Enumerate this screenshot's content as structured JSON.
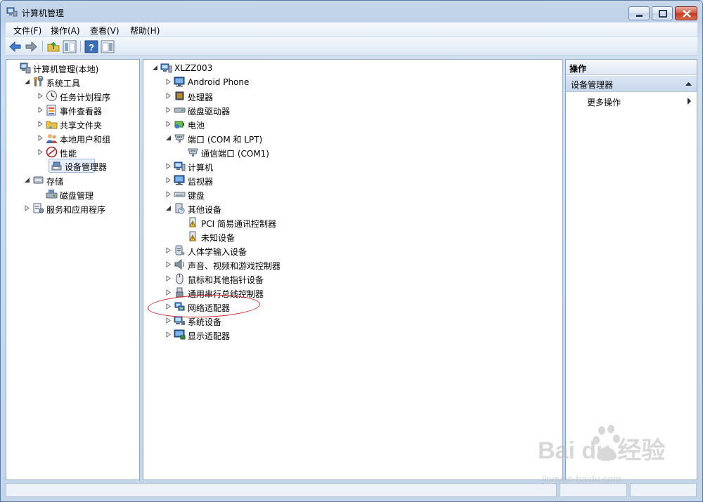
{
  "window": {
    "title": "计算机管理"
  },
  "menu": [
    "文件(F)",
    "操作(A)",
    "查看(V)",
    "帮助(H)"
  ],
  "left_tree": [
    {
      "label": "计算机管理(本地)",
      "icon": "computer-management-icon",
      "indent": 0,
      "expander": "none"
    },
    {
      "label": "系统工具",
      "icon": "tools-icon",
      "indent": 1,
      "expander": "expanded"
    },
    {
      "label": "任务计划程序",
      "icon": "clock-icon",
      "indent": 2,
      "expander": "collapsed"
    },
    {
      "label": "事件查看器",
      "icon": "event-viewer-icon",
      "indent": 2,
      "expander": "collapsed"
    },
    {
      "label": "共享文件夹",
      "icon": "shared-folder-icon",
      "indent": 2,
      "expander": "collapsed"
    },
    {
      "label": "本地用户和组",
      "icon": "users-icon",
      "indent": 2,
      "expander": "collapsed"
    },
    {
      "label": "性能",
      "icon": "performance-icon",
      "indent": 2,
      "expander": "collapsed"
    },
    {
      "label": "设备管理器",
      "icon": "device-manager-icon",
      "indent": 2,
      "expander": "none",
      "selected": true
    },
    {
      "label": "存储",
      "icon": "storage-icon",
      "indent": 1,
      "expander": "expanded"
    },
    {
      "label": "磁盘管理",
      "icon": "disk-management-icon",
      "indent": 2,
      "expander": "none"
    },
    {
      "label": "服务和应用程序",
      "icon": "services-icon",
      "indent": 1,
      "expander": "collapsed"
    }
  ],
  "device_tree": [
    {
      "label": "XLZZ003",
      "icon": "computer-icon",
      "indent": 0,
      "expander": "expanded"
    },
    {
      "label": "Android Phone",
      "icon": "monitor-icon",
      "indent": 1,
      "expander": "collapsed"
    },
    {
      "label": "处理器",
      "icon": "cpu-icon",
      "indent": 1,
      "expander": "collapsed"
    },
    {
      "label": "磁盘驱动器",
      "icon": "disk-drive-icon",
      "indent": 1,
      "expander": "collapsed"
    },
    {
      "label": "电池",
      "icon": "battery-icon",
      "indent": 1,
      "expander": "collapsed"
    },
    {
      "label": "端口 (COM 和 LPT)",
      "icon": "port-icon",
      "indent": 1,
      "expander": "expanded"
    },
    {
      "label": "通信端口 (COM1)",
      "icon": "port-icon",
      "indent": 2,
      "expander": "none"
    },
    {
      "label": "计算机",
      "icon": "computer-icon",
      "indent": 1,
      "expander": "collapsed"
    },
    {
      "label": "监视器",
      "icon": "monitor-icon",
      "indent": 1,
      "expander": "collapsed"
    },
    {
      "label": "键盘",
      "icon": "keyboard-icon",
      "indent": 1,
      "expander": "collapsed"
    },
    {
      "label": "其他设备",
      "icon": "unknown-device-icon",
      "indent": 1,
      "expander": "expanded"
    },
    {
      "label": "PCI 简易通讯控制器",
      "icon": "warning-device-icon",
      "indent": 2,
      "expander": "none"
    },
    {
      "label": "未知设备",
      "icon": "warning-device-icon",
      "indent": 2,
      "expander": "none"
    },
    {
      "label": "人体学输入设备",
      "icon": "hid-icon",
      "indent": 1,
      "expander": "collapsed"
    },
    {
      "label": "声音、视频和游戏控制器",
      "icon": "speaker-icon",
      "indent": 1,
      "expander": "collapsed"
    },
    {
      "label": "鼠标和其他指针设备",
      "icon": "mouse-icon",
      "indent": 1,
      "expander": "collapsed"
    },
    {
      "label": "通用串行总线控制器",
      "icon": "usb-icon",
      "indent": 1,
      "expander": "collapsed"
    },
    {
      "label": "网络适配器",
      "icon": "network-adapter-icon",
      "indent": 1,
      "expander": "collapsed",
      "highlighted": true
    },
    {
      "label": "系统设备",
      "icon": "system-devices-icon",
      "indent": 1,
      "expander": "collapsed"
    },
    {
      "label": "显示适配器",
      "icon": "display-adapter-icon",
      "indent": 1,
      "expander": "collapsed"
    }
  ],
  "actions": {
    "header": "操作",
    "section": "设备管理器",
    "items": [
      "更多操作"
    ]
  },
  "watermark": {
    "text": "Bai du 经验",
    "url_text": "jingyan.baidu.com"
  },
  "colors": {
    "highlight_ellipse": "#d2252b",
    "selection": "#e6eefb"
  }
}
